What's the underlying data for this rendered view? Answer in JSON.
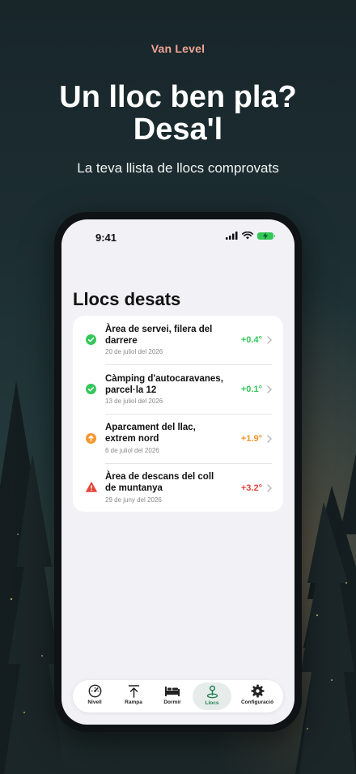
{
  "promo": {
    "app_name": "Van Level",
    "headline": "Un lloc ben pla? Desa'l",
    "subheadline": "La teva llista de llocs comprovats"
  },
  "status_bar": {
    "time": "9:41"
  },
  "screen": {
    "title": "Llocs desats",
    "places": [
      {
        "title": "Àrea de servei, filera del darrere",
        "date": "20 de juliol del 2026",
        "value": "+0.4°",
        "status": "ok",
        "color": "#34c759"
      },
      {
        "title": "Càmping d'autocaravanes, parcel·la 12",
        "date": "13 de juliol del 2026",
        "value": "+0.1°",
        "status": "ok",
        "color": "#34c759"
      },
      {
        "title": "Aparcament del llac, extrem nord",
        "date": "6 de juliol del 2026",
        "value": "+1.9°",
        "status": "caution",
        "color": "#f7962c"
      },
      {
        "title": "Àrea de descans del coll de muntanya",
        "date": "29 de juny del 2026",
        "value": "+3.2°",
        "status": "warning",
        "color": "#e5443a"
      }
    ]
  },
  "tab_bar": {
    "tabs": [
      {
        "label": "Nivell",
        "icon": "gauge-icon"
      },
      {
        "label": "Rampa",
        "icon": "ramp-arrow-icon"
      },
      {
        "label": "Dormir",
        "icon": "bed-icon"
      },
      {
        "label": "Llocs",
        "icon": "location-pin-icon",
        "active": true
      },
      {
        "label": "Configuració",
        "icon": "gear-icon"
      }
    ]
  },
  "colors": {
    "accent": "#1e7d4e",
    "promo_label": "#f0a595",
    "ok": "#34c759",
    "caution": "#f7962c",
    "warning": "#e5443a"
  }
}
